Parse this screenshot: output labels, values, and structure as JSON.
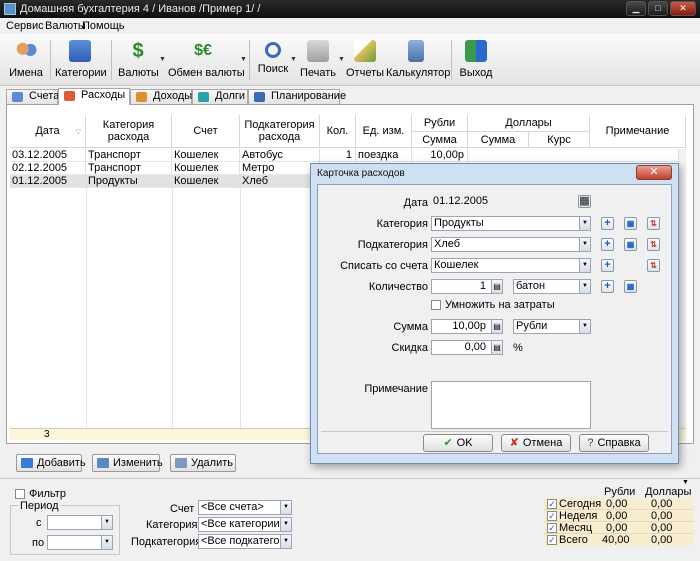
{
  "window": {
    "title": "Домашняя бухгалтерия 4 / Иванов /Пример 1/ /"
  },
  "menu": [
    "Сервис",
    "Валюты",
    "Помощь"
  ],
  "toolbar": {
    "names": "Имена",
    "categories": "Категории",
    "currencies": "Валюты",
    "exchange": "Обмен валюты",
    "search": "Поиск",
    "print": "Печать",
    "reports": "Отчеты",
    "calculator": "Калькулятор",
    "exit": "Выход"
  },
  "tabs": [
    "Счета",
    "Расходы",
    "Доходы",
    "Долги",
    "Планирование"
  ],
  "grid": {
    "headers": {
      "date": "Дата",
      "category": "Категория расхода",
      "account": "Счет",
      "subcategory": "Подкатегория расхода",
      "qty": "Кол.",
      "unit": "Ед. изм.",
      "rub_group": "Рубли",
      "rub_sum": "Сумма",
      "usd_group": "Доллары",
      "usd_sum": "Сумма",
      "usd_rate": "Курс",
      "note": "Примечание"
    },
    "rows": [
      {
        "date": "03.12.2005",
        "category": "Транспорт",
        "account": "Кошелек",
        "subcategory": "Автобус",
        "qty": "1",
        "unit": "поездка",
        "sum": "10,00р"
      },
      {
        "date": "02.12.2005",
        "category": "Транспорт",
        "account": "Кошелек",
        "subcategory": "Метро",
        "qty": "",
        "unit": "",
        "sum": ""
      },
      {
        "date": "01.12.2005",
        "category": "Продукты",
        "account": "Кошелек",
        "subcategory": "Хлеб",
        "qty": "",
        "unit": "",
        "sum": ""
      }
    ],
    "footer_count": "3"
  },
  "actions": {
    "add": "Добавить",
    "edit": "Изменить",
    "delete": "Удалить"
  },
  "filter": {
    "label": "Фильтр",
    "period": "Период",
    "from": "с",
    "to": "по",
    "account_label": "Счет",
    "account_value": "<Все счета>",
    "category_label": "Категория",
    "category_value": "<Все категории>",
    "subcategory_label": "Подкатегория",
    "subcategory_value": "<Все подкатегори"
  },
  "summary": {
    "col_rub": "Рубли",
    "col_usd": "Доллары",
    "rows": [
      {
        "label": "Сегодня",
        "rub": "0,00",
        "usd": "0,00"
      },
      {
        "label": "Неделя",
        "rub": "0,00",
        "usd": "0,00"
      },
      {
        "label": "Месяц",
        "rub": "0,00",
        "usd": "0,00"
      },
      {
        "label": "Всего",
        "rub": "40,00",
        "usd": "0,00"
      }
    ]
  },
  "dialog": {
    "title": "Карточка расходов",
    "close": "✕",
    "date_label": "Дата",
    "date_value": "01.12.2005",
    "category_label": "Категория",
    "category_value": "Продукты",
    "subcategory_label": "Подкатегория",
    "subcategory_value": "Хлеб",
    "account_label": "Списать со счета",
    "account_value": "Кошелек",
    "qty_label": "Количество",
    "qty_value": "1",
    "unit_value": "батон",
    "multiply_label": "Умножить на затраты",
    "sum_label": "Сумма",
    "sum_value": "10,00р",
    "currency_value": "Рубли",
    "discount_label": "Скидка",
    "discount_value": "0,00",
    "percent": "%",
    "note_label": "Примечание",
    "ok": "OK",
    "cancel": "Отмена",
    "help": "Справка"
  }
}
